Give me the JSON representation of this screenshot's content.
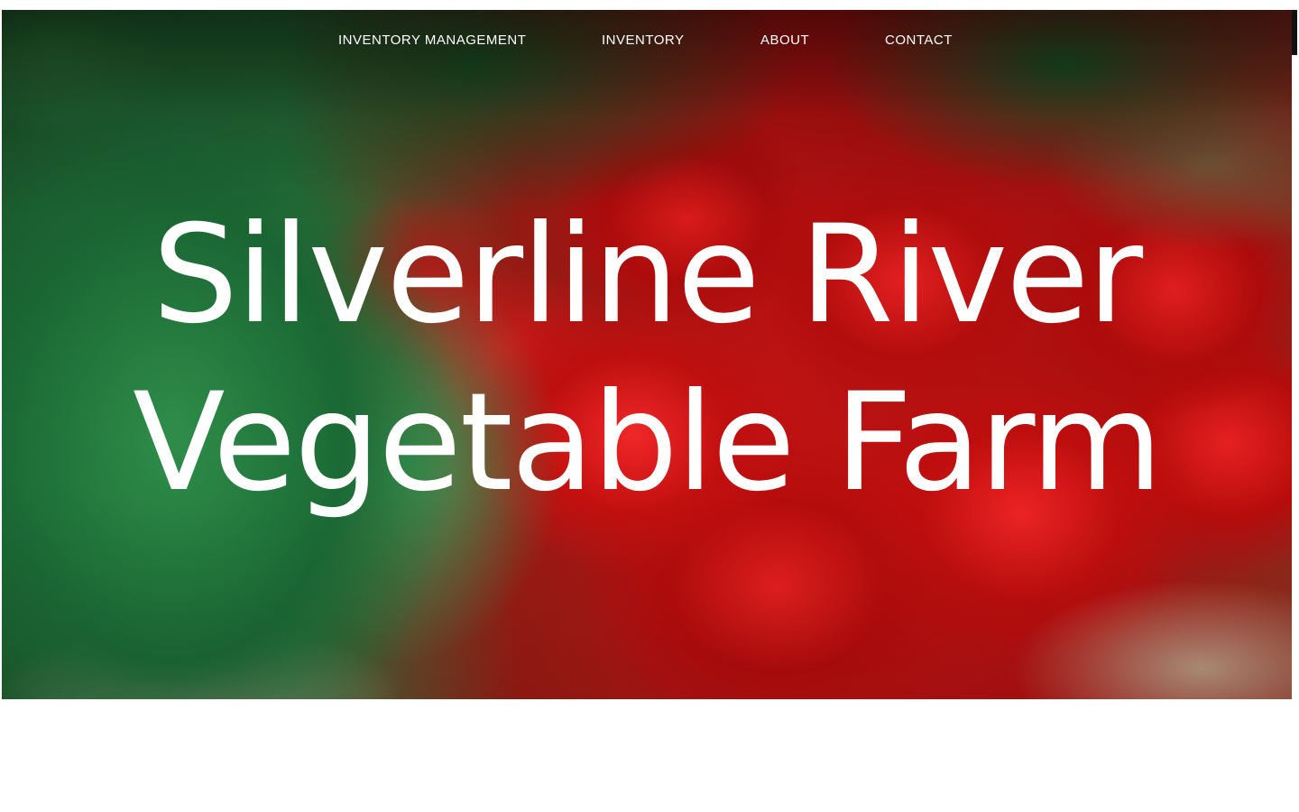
{
  "nav": {
    "items": [
      {
        "label": "INVENTORY MANAGEMENT"
      },
      {
        "label": "INVENTORY"
      },
      {
        "label": "ABOUT"
      },
      {
        "label": "CONTACT"
      }
    ]
  },
  "hero": {
    "title": "Silverline River Vegetable Farm",
    "background": "photo of tomatoes and greens",
    "colors": {
      "text": "#ffffff",
      "tomato_red": "#d81a1a",
      "leaf_green": "#2f8f4a"
    }
  }
}
